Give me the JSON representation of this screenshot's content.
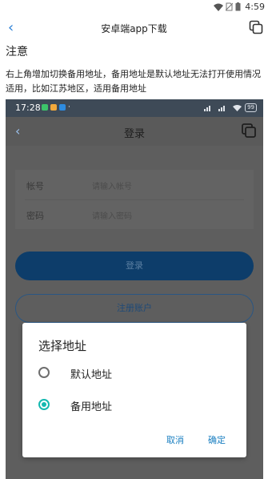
{
  "device_status": {
    "time": "4:59"
  },
  "app_bar": {
    "back_glyph": "‹",
    "title": "安卓端app下载"
  },
  "notice": {
    "heading": "注意",
    "body": "右上角增加切换备用地址，备用地址是默认地址无法打开使用情况适用，比如江苏地区，适用备用地址"
  },
  "screenshot": {
    "status_time": "17:28",
    "status_dot": "·",
    "battery": "99",
    "header": {
      "back_glyph": "‹",
      "title": "登录"
    },
    "form": {
      "account_label": "帐号",
      "account_placeholder": "请输入帐号",
      "password_label": "密码",
      "password_placeholder": "请输入密码"
    },
    "login_button": "登录",
    "register_button": "注册账户",
    "dialog": {
      "title": "选择地址",
      "options": [
        {
          "label": "默认地址",
          "selected": false
        },
        {
          "label": "备用地址",
          "selected": true
        }
      ],
      "cancel": "取消",
      "confirm": "确定"
    }
  },
  "colors": {
    "accent": "#2a7fd6",
    "radio_selected": "#14b8b0",
    "dialog_button": "#1a7fc1"
  }
}
